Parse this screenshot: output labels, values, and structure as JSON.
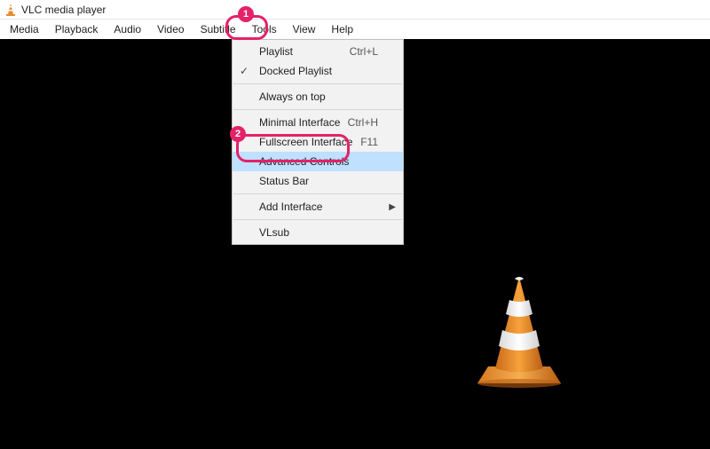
{
  "titlebar": {
    "title": "VLC media player"
  },
  "menubar": {
    "items": [
      "Media",
      "Playback",
      "Audio",
      "Video",
      "Subtitle",
      "Tools",
      "View",
      "Help"
    ]
  },
  "view_menu": {
    "items": [
      {
        "label": "Playlist",
        "shortcut": "Ctrl+L",
        "checked": false,
        "submenu": false,
        "highlight": false
      },
      {
        "label": "Docked Playlist",
        "shortcut": "",
        "checked": true,
        "submenu": false,
        "highlight": false
      },
      {
        "sep": true
      },
      {
        "label": "Always on top",
        "shortcut": "",
        "checked": false,
        "submenu": false,
        "highlight": false
      },
      {
        "sep": true
      },
      {
        "label": "Minimal Interface",
        "shortcut": "Ctrl+H",
        "checked": false,
        "submenu": false,
        "highlight": false
      },
      {
        "label": "Fullscreen Interface",
        "shortcut": "F11",
        "checked": false,
        "submenu": false,
        "highlight": false
      },
      {
        "label": "Advanced Controls",
        "shortcut": "",
        "checked": false,
        "submenu": false,
        "highlight": true
      },
      {
        "label": "Status Bar",
        "shortcut": "",
        "checked": false,
        "submenu": false,
        "highlight": false
      },
      {
        "sep": true
      },
      {
        "label": "Add Interface",
        "shortcut": "",
        "checked": false,
        "submenu": true,
        "highlight": false
      },
      {
        "sep": true
      },
      {
        "label": "VLsub",
        "shortcut": "",
        "checked": false,
        "submenu": false,
        "highlight": false
      }
    ]
  },
  "annotations": {
    "badge1": "1",
    "badge2": "2"
  }
}
